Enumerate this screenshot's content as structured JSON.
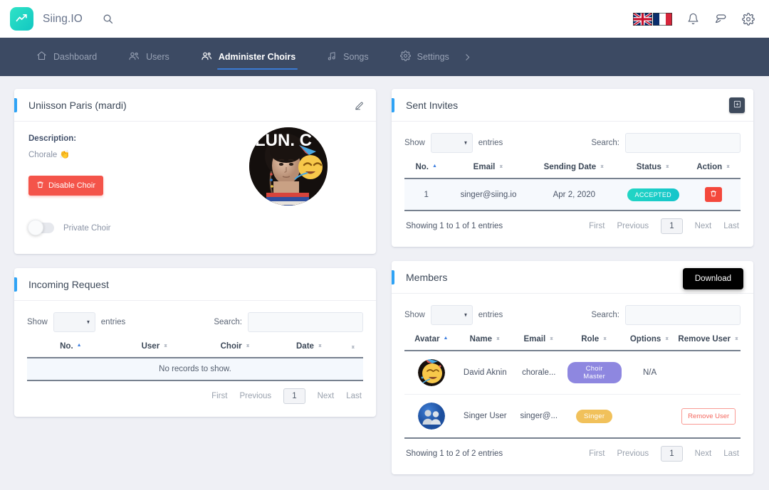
{
  "topbar": {
    "logo_text": "Siing.IO",
    "search_icon": "search-icon",
    "flags": [
      "flag-uk",
      "flag-france"
    ],
    "icons": [
      "bell-icon",
      "chat-icon",
      "gear-icon"
    ]
  },
  "nav": {
    "items": [
      {
        "label": "Dashboard",
        "icon": "home-icon",
        "active": false
      },
      {
        "label": "Users",
        "icon": "users-icon",
        "active": false
      },
      {
        "label": "Administer Choirs",
        "icon": "users-icon",
        "active": true
      },
      {
        "label": "Songs",
        "icon": "music-note-icon",
        "active": false
      },
      {
        "label": "Settings",
        "icon": "gear-icon",
        "active": false
      }
    ],
    "overflow_icon": "chevron-right-icon"
  },
  "choir": {
    "title": "Uniisson Paris (mardi)",
    "edit_icon": "pencil-icon",
    "description_label": "Description:",
    "description_value": "Chorale 👏",
    "disable_button": "Disable Choir",
    "disable_icon": "trash-icon",
    "private_toggle_label": "Private Choir",
    "private_toggle_on": false,
    "avatar_overlay_text": "LUN. C"
  },
  "incoming": {
    "title": "Incoming Request",
    "show_label": "Show",
    "entries_label": "entries",
    "page_size": "",
    "search_label": "Search:",
    "search_value": "",
    "search_placeholder": "",
    "columns": [
      "No.",
      "User",
      "Choir",
      "Date",
      ""
    ],
    "empty_text": "No records to show.",
    "info": "",
    "pager": {
      "first": "First",
      "previous": "Previous",
      "current": "1",
      "next": "Next",
      "last": "Last"
    }
  },
  "invites": {
    "title": "Sent Invites",
    "add_icon": "add-box-icon",
    "show_label": "Show",
    "entries_label": "entries",
    "page_size": "",
    "search_label": "Search:",
    "search_value": "",
    "search_placeholder": "",
    "columns": [
      "No.",
      "Email",
      "Sending Date",
      "Status",
      "Action"
    ],
    "rows": [
      {
        "no": "1",
        "email": "singer@siing.io",
        "date": "Apr 2, 2020",
        "status": "ACCEPTED",
        "action_icon": "trash-icon"
      }
    ],
    "info": "Showing 1 to 1 of 1 entries",
    "pager": {
      "first": "First",
      "previous": "Previous",
      "current": "1",
      "next": "Next",
      "last": "Last"
    }
  },
  "members": {
    "title": "Members",
    "download_tooltip": "Download",
    "show_label": "Show",
    "entries_label": "entries",
    "page_size": "",
    "search_label": "Search:",
    "search_value": "",
    "search_placeholder": "",
    "columns": [
      "Avatar",
      "Name",
      "Email",
      "Role",
      "Options",
      "Remove User"
    ],
    "rows": [
      {
        "avatar": "party-face-emoji-avatar",
        "name": "David Aknin",
        "email": "chorale...",
        "role": "Choir Master",
        "options": "N/A",
        "remove": ""
      },
      {
        "avatar": "default-users-avatar",
        "name": "Singer User",
        "email": "singer@...",
        "role": "Singer",
        "options": "",
        "remove": "Remove User"
      }
    ],
    "info": "Showing 1 to 2 of 2 entries",
    "pager": {
      "first": "First",
      "previous": "Previous",
      "current": "1",
      "next": "Next",
      "last": "Last"
    }
  },
  "colors": {
    "page_bg": "#eff0f5",
    "nav_bg": "#3c4a63",
    "accent_blue": "#2fa3f5",
    "danger_red": "#f4544a",
    "accepted_teal": "#14c4cb",
    "role_master_purple": "#8e87e0",
    "role_singer_amber": "#f1c15b",
    "brand_teal": "#12c7c2"
  }
}
